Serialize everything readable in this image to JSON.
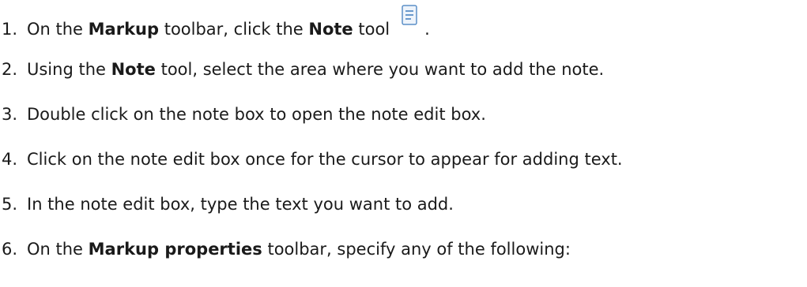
{
  "steps": [
    {
      "number": "1.",
      "parts": [
        "On the ",
        "Markup",
        " toolbar, click the ",
        "Note",
        " tool",
        "."
      ],
      "icon": "note-tool-icon"
    },
    {
      "number": "2.",
      "parts": [
        "Using the ",
        "Note",
        " tool, select the area where you want to add the note."
      ]
    },
    {
      "number": "3.",
      "parts": [
        "Double click on the note box to open the note edit box."
      ]
    },
    {
      "number": "4.",
      "parts": [
        "Click on the note edit box once for the cursor to appear for adding text."
      ]
    },
    {
      "number": "5.",
      "parts": [
        "In the note edit box, type the text you want to add."
      ]
    },
    {
      "number": "6.",
      "parts": [
        "On the ",
        "Markup properties",
        " toolbar, specify any of the following:"
      ]
    }
  ],
  "colors": {
    "text": "#1a1a1a",
    "icon_stroke": "#5b8fc7",
    "icon_fill": "#eef4fb"
  }
}
